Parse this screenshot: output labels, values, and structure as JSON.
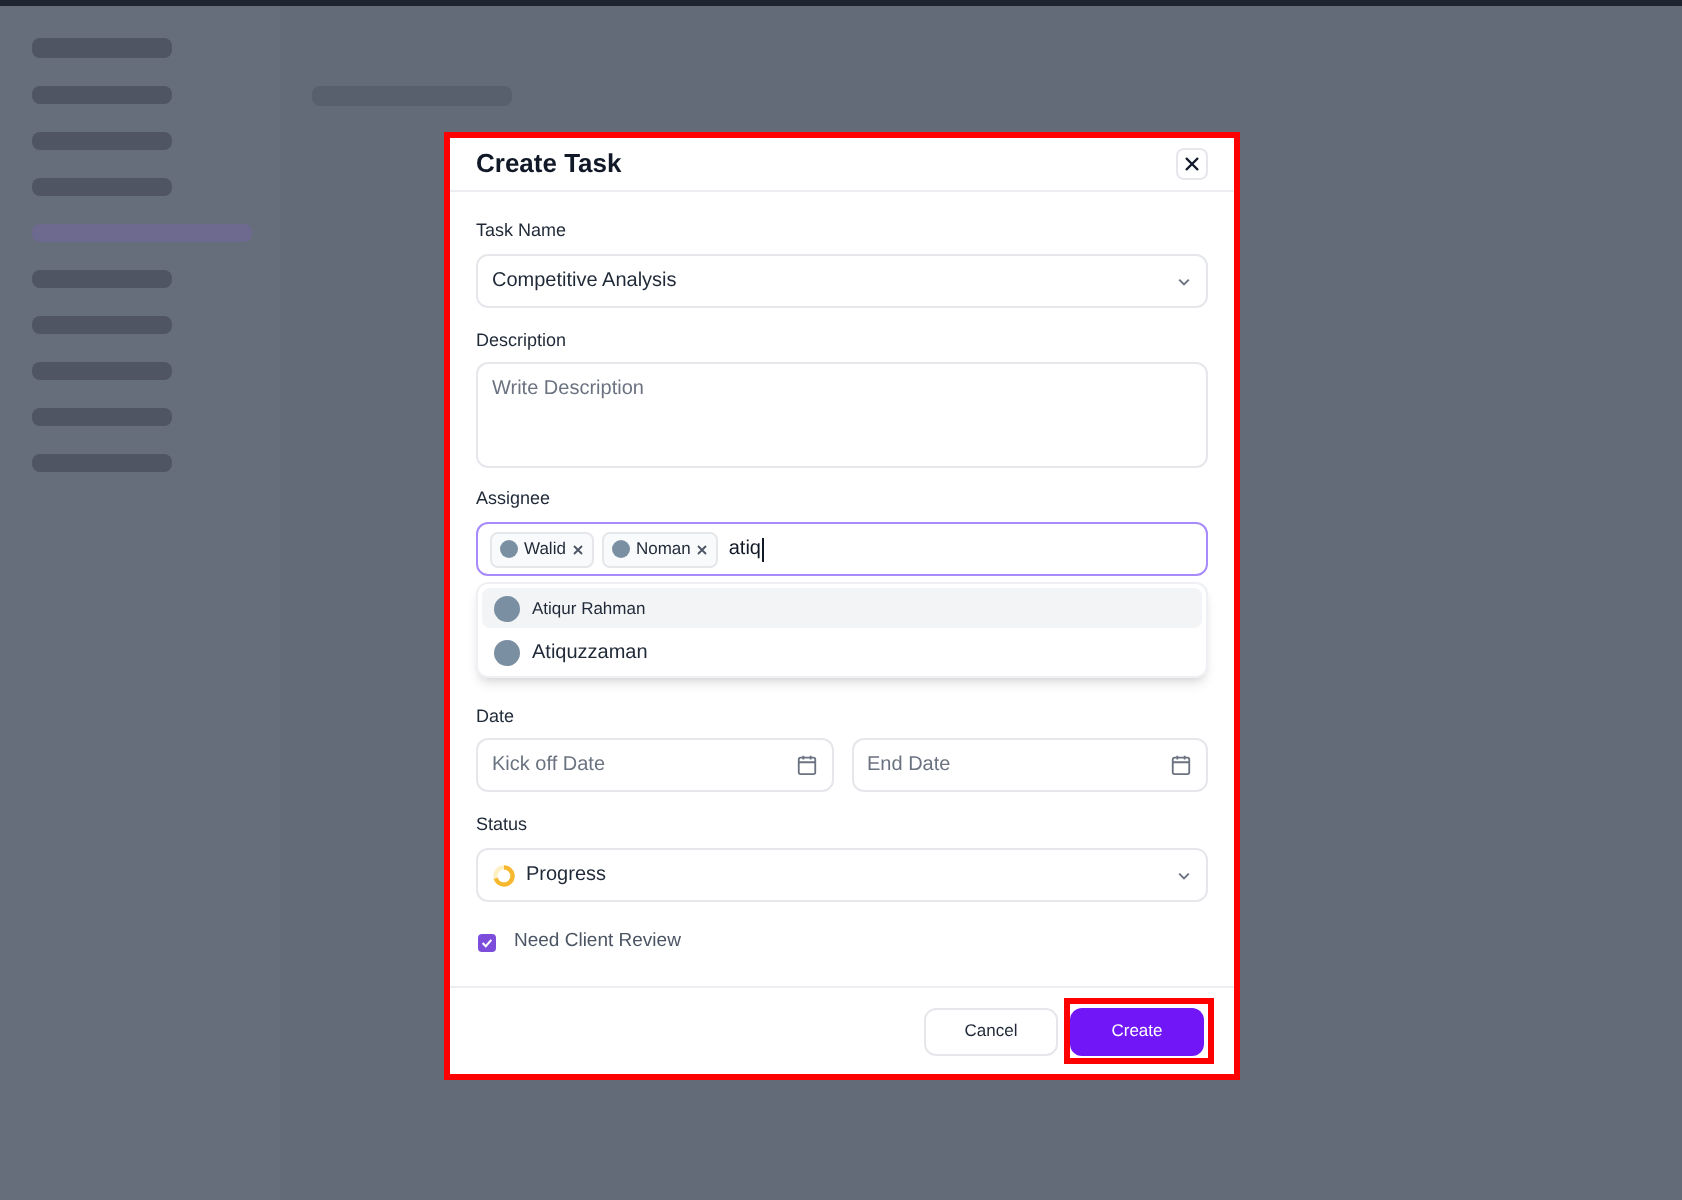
{
  "dialog": {
    "title": "Create Task",
    "highlighted": true,
    "task_name": {
      "label": "Task Name",
      "value": "Competitive Analysis"
    },
    "description": {
      "label": "Description",
      "placeholder": "Write Description"
    },
    "assignee": {
      "label": "Assignee",
      "chips": [
        {
          "name": "Walid"
        },
        {
          "name": "Noman"
        }
      ],
      "query": "atiq",
      "suggestions": [
        {
          "name": "Atiqur Rahman",
          "selected": true
        },
        {
          "name": "Atiquzzaman",
          "selected": false
        }
      ]
    },
    "date": {
      "label": "Date",
      "start_placeholder": "Kick off Date",
      "end_placeholder": "End Date"
    },
    "status": {
      "label": "Status",
      "value": "Progress"
    },
    "review": {
      "label": "Need Client Review",
      "checked": true
    },
    "buttons": [
      {
        "kind": "secondary",
        "label": "Cancel",
        "highlighted": false
      },
      {
        "kind": "primary",
        "label": "Create",
        "highlighted": true
      }
    ]
  }
}
